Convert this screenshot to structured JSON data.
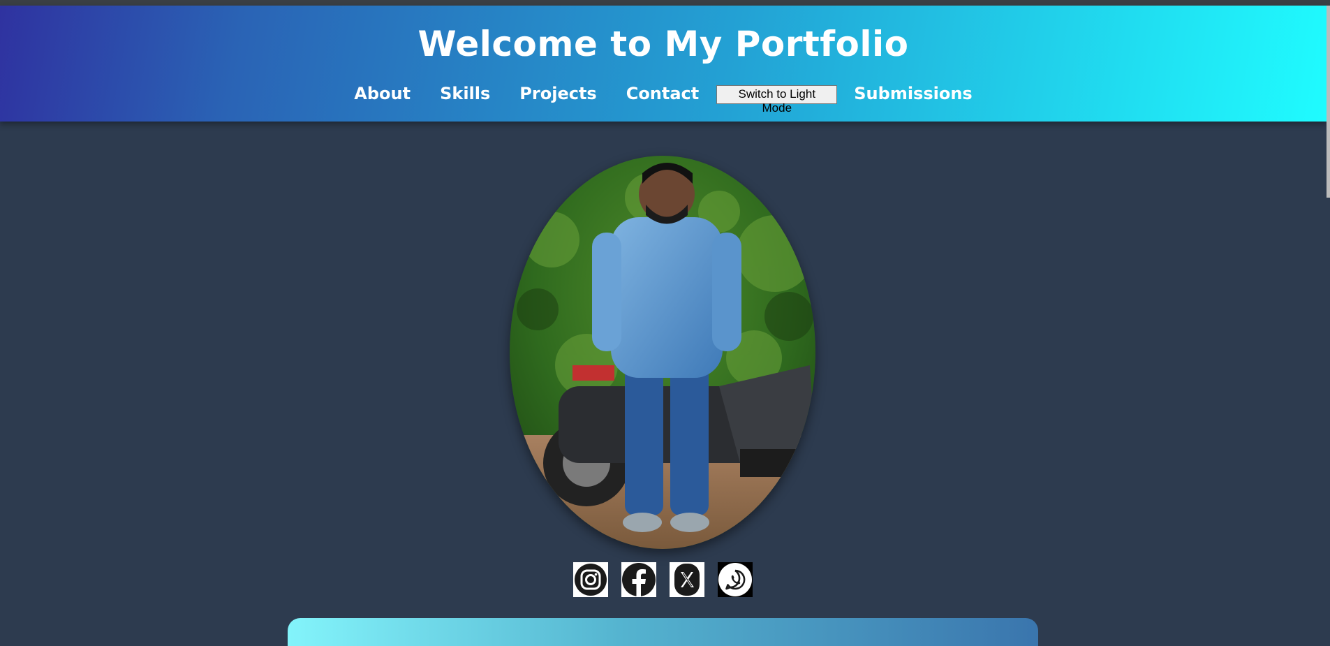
{
  "header": {
    "title": "Welcome to My Portfolio",
    "nav": [
      {
        "label": "About"
      },
      {
        "label": "Skills"
      },
      {
        "label": "Projects"
      },
      {
        "label": "Contact"
      }
    ],
    "theme_toggle_label": "Switch to Light Mode",
    "submissions_label": "Submissions"
  },
  "social": [
    {
      "icon": "instagram-icon"
    },
    {
      "icon": "facebook-icon"
    },
    {
      "icon": "x-icon"
    },
    {
      "icon": "whatsapp-icon"
    }
  ],
  "colors": {
    "page_background": "#2d3b4f",
    "header_gradient_start": "#2f32a0",
    "header_gradient_end": "#1ffcff"
  }
}
